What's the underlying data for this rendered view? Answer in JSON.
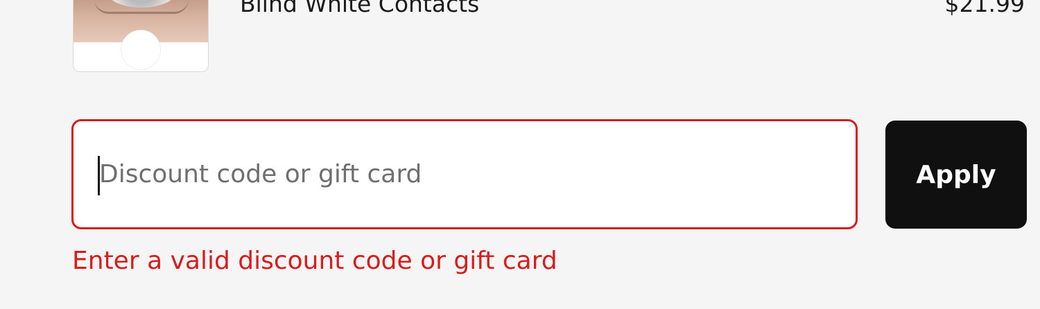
{
  "product": {
    "name": "Blind White Contacts",
    "price": "$21.99",
    "thumbnail_icon": "contact-lens-product-image"
  },
  "discount": {
    "placeholder": "Discount code or gift card",
    "value": "",
    "apply_label": "Apply",
    "error": "Enter a valid discount code or gift card"
  },
  "colors": {
    "page_background": "#f5f5f5",
    "error": "#d81b1b",
    "button_background": "#101010",
    "button_text": "#ffffff"
  }
}
